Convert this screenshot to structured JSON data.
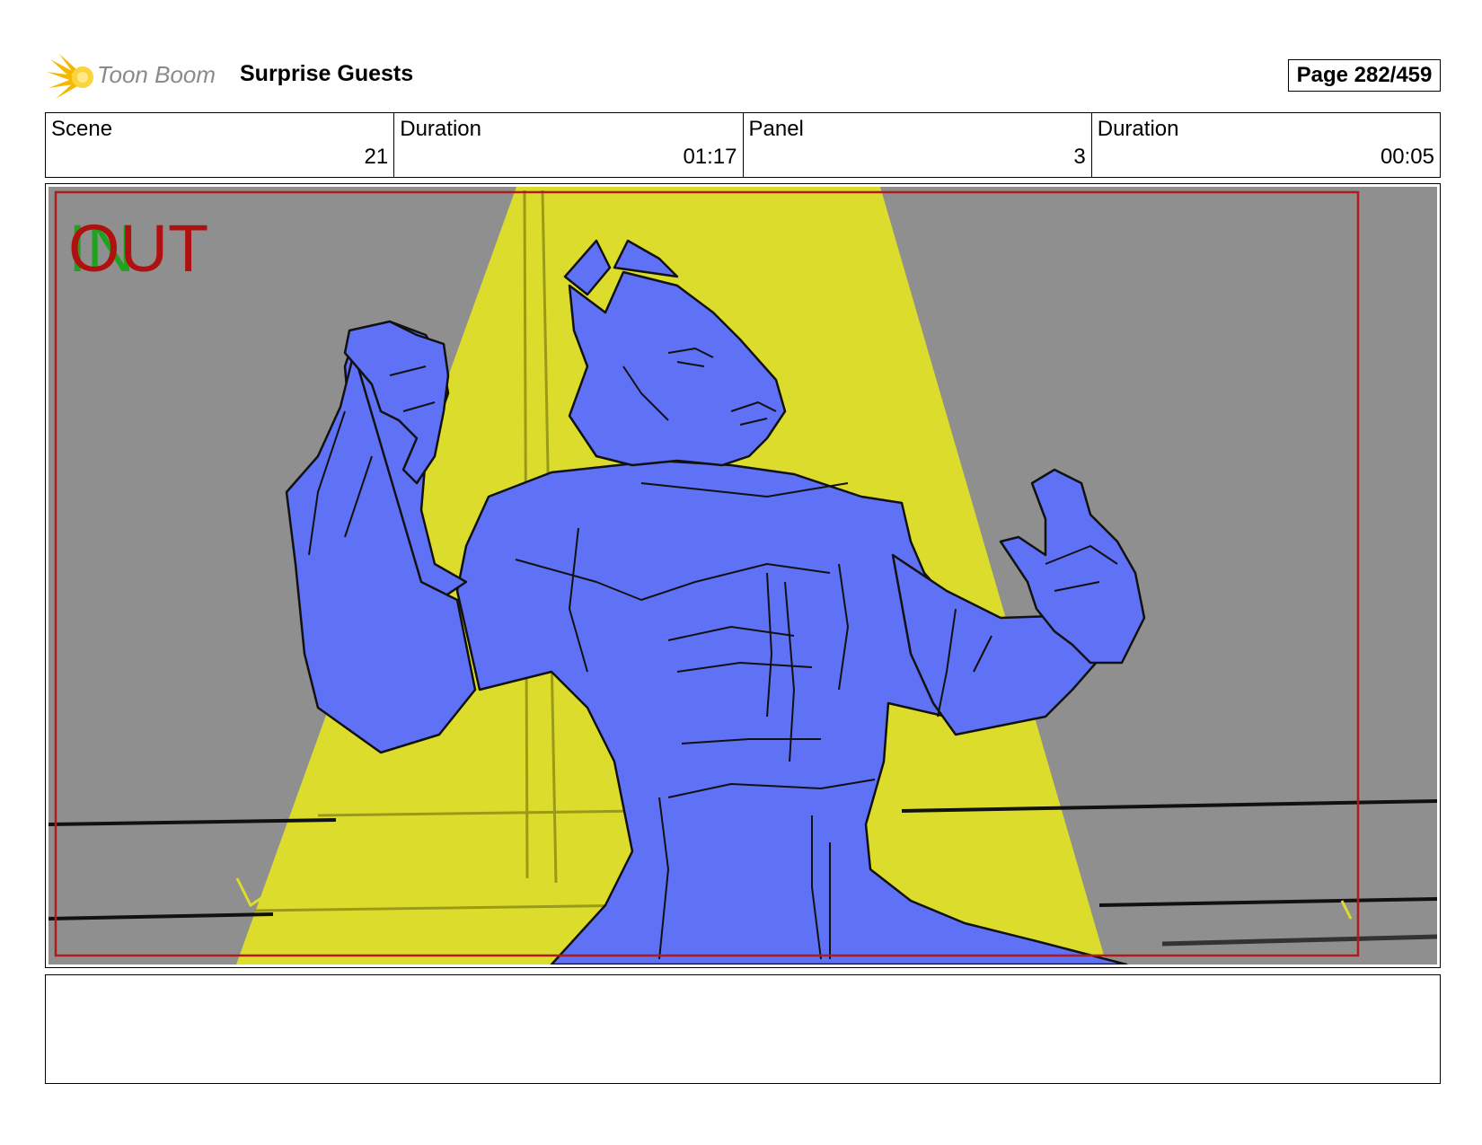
{
  "header": {
    "logo_text": "Toon Boom",
    "title": "Surprise Guests",
    "page_label": "Page 282/459"
  },
  "info": {
    "scene_label": "Scene",
    "scene_value": "21",
    "scene_duration_label": "Duration",
    "scene_duration_value": "01:17",
    "panel_label": "Panel",
    "panel_value": "3",
    "panel_duration_label": "Duration",
    "panel_duration_value": "00:05"
  },
  "panel": {
    "in_marker": "IN",
    "out_marker": "OUT"
  },
  "notes": {
    "text": ""
  },
  "colors": {
    "background_wall": "#8f8f8f",
    "spotlight": "#dcdc2c",
    "character_fill": "#5f72f6",
    "frame_border": "#b01a1a",
    "in_marker": "#1fa31f",
    "out_marker": "#b01010"
  }
}
